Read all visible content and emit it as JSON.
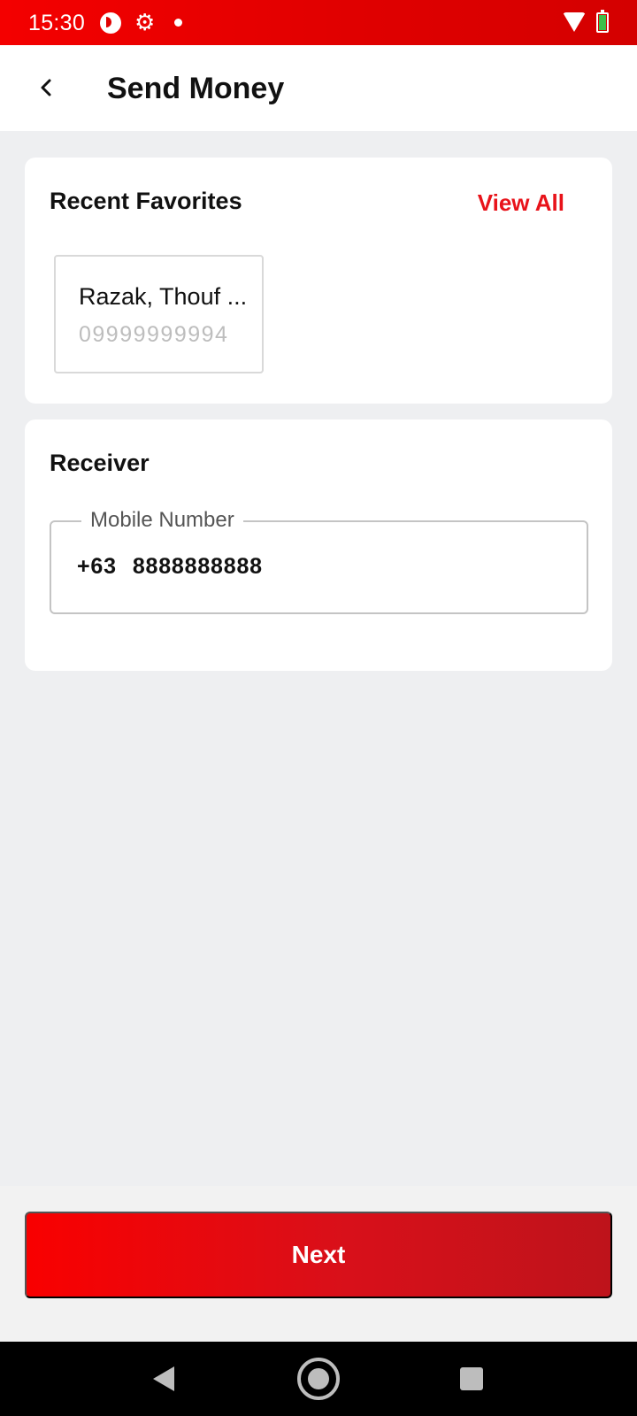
{
  "status_bar": {
    "time": "15:30",
    "icons": [
      "app-notification-icon",
      "gear-icon",
      "dot-icon",
      "wifi-icon",
      "battery-charging-icon"
    ]
  },
  "app_bar": {
    "back_icon": "chevron-left-icon",
    "title": "Send Money"
  },
  "favorites": {
    "heading": "Recent Favorites",
    "view_all": "View All",
    "items": [
      {
        "name": "Razak, Thouf ...",
        "number": "09999999994"
      }
    ]
  },
  "receiver": {
    "heading": "Receiver",
    "mobile_field": {
      "label": "Mobile Number",
      "country_code": "+63",
      "value": "8888888888"
    }
  },
  "actions": {
    "next_label": "Next"
  },
  "nav_bar": {
    "icons": [
      "nav-back-icon",
      "nav-home-icon",
      "nav-recents-icon"
    ]
  },
  "colors": {
    "brand_red": "#e8131a",
    "next_gradient_start": "#f90000",
    "next_gradient_end": "#be131b",
    "page_background": "#eeeff1"
  }
}
